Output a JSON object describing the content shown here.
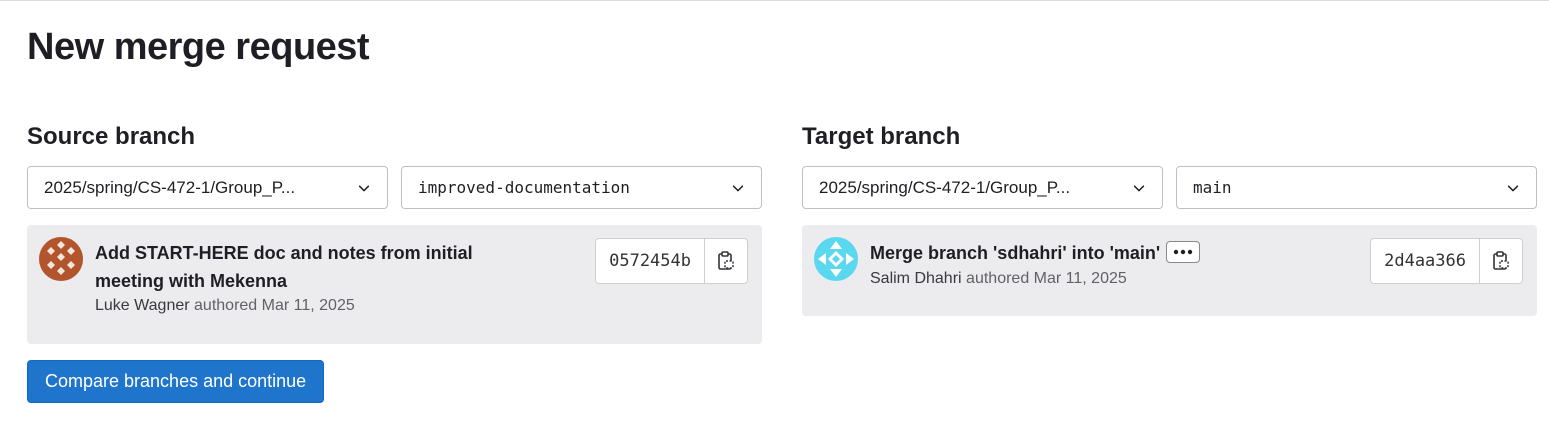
{
  "page": {
    "title": "New merge request"
  },
  "source": {
    "heading": "Source branch",
    "project": "2025/spring/CS-472-1/Group_P...",
    "branch": "improved-documentation",
    "commit": {
      "title": "Add START-HERE doc and notes from initial meeting with Mekenna",
      "author": "Luke Wagner",
      "authored_label": "authored",
      "date": "Mar 11, 2025",
      "sha": "0572454b",
      "avatar_color": "#b2552c",
      "avatar_icon": "identicon-avatar"
    }
  },
  "target": {
    "heading": "Target branch",
    "project": "2025/spring/CS-472-1/Group_P...",
    "branch": "main",
    "commit": {
      "title": "Merge branch 'sdhahri' into 'main'",
      "author": "Salim Dhahri",
      "authored_label": "authored",
      "date": "Mar 11, 2025",
      "sha": "2d4aa366",
      "avatar_color": "#5ad8f0",
      "avatar_icon": "identicon-avatar"
    }
  },
  "actions": {
    "compare_label": "Compare branches and continue"
  },
  "colors": {
    "primary": "#1f75cb",
    "card_bg": "#ececef",
    "border": "#bfbfc3"
  }
}
